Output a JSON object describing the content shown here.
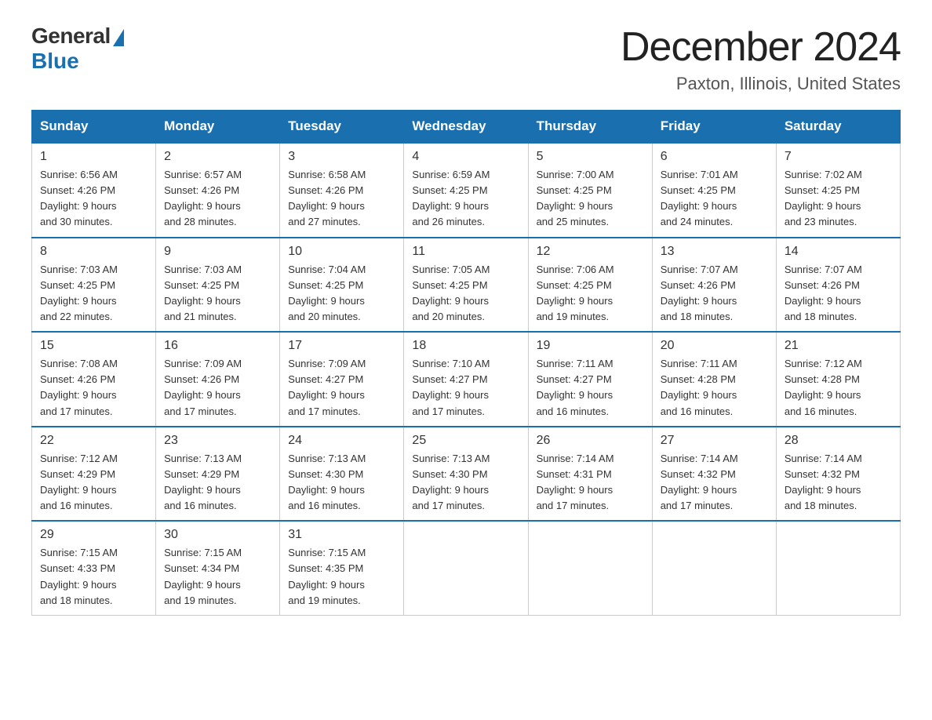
{
  "header": {
    "logo": {
      "general": "General",
      "blue": "Blue"
    },
    "title": "December 2024",
    "location": "Paxton, Illinois, United States"
  },
  "days_of_week": [
    "Sunday",
    "Monday",
    "Tuesday",
    "Wednesday",
    "Thursday",
    "Friday",
    "Saturday"
  ],
  "weeks": [
    [
      {
        "day": "1",
        "sunrise": "6:56 AM",
        "sunset": "4:26 PM",
        "daylight": "9 hours and 30 minutes."
      },
      {
        "day": "2",
        "sunrise": "6:57 AM",
        "sunset": "4:26 PM",
        "daylight": "9 hours and 28 minutes."
      },
      {
        "day": "3",
        "sunrise": "6:58 AM",
        "sunset": "4:26 PM",
        "daylight": "9 hours and 27 minutes."
      },
      {
        "day": "4",
        "sunrise": "6:59 AM",
        "sunset": "4:25 PM",
        "daylight": "9 hours and 26 minutes."
      },
      {
        "day": "5",
        "sunrise": "7:00 AM",
        "sunset": "4:25 PM",
        "daylight": "9 hours and 25 minutes."
      },
      {
        "day": "6",
        "sunrise": "7:01 AM",
        "sunset": "4:25 PM",
        "daylight": "9 hours and 24 minutes."
      },
      {
        "day": "7",
        "sunrise": "7:02 AM",
        "sunset": "4:25 PM",
        "daylight": "9 hours and 23 minutes."
      }
    ],
    [
      {
        "day": "8",
        "sunrise": "7:03 AM",
        "sunset": "4:25 PM",
        "daylight": "9 hours and 22 minutes."
      },
      {
        "day": "9",
        "sunrise": "7:03 AM",
        "sunset": "4:25 PM",
        "daylight": "9 hours and 21 minutes."
      },
      {
        "day": "10",
        "sunrise": "7:04 AM",
        "sunset": "4:25 PM",
        "daylight": "9 hours and 20 minutes."
      },
      {
        "day": "11",
        "sunrise": "7:05 AM",
        "sunset": "4:25 PM",
        "daylight": "9 hours and 20 minutes."
      },
      {
        "day": "12",
        "sunrise": "7:06 AM",
        "sunset": "4:25 PM",
        "daylight": "9 hours and 19 minutes."
      },
      {
        "day": "13",
        "sunrise": "7:07 AM",
        "sunset": "4:26 PM",
        "daylight": "9 hours and 18 minutes."
      },
      {
        "day": "14",
        "sunrise": "7:07 AM",
        "sunset": "4:26 PM",
        "daylight": "9 hours and 18 minutes."
      }
    ],
    [
      {
        "day": "15",
        "sunrise": "7:08 AM",
        "sunset": "4:26 PM",
        "daylight": "9 hours and 17 minutes."
      },
      {
        "day": "16",
        "sunrise": "7:09 AM",
        "sunset": "4:26 PM",
        "daylight": "9 hours and 17 minutes."
      },
      {
        "day": "17",
        "sunrise": "7:09 AM",
        "sunset": "4:27 PM",
        "daylight": "9 hours and 17 minutes."
      },
      {
        "day": "18",
        "sunrise": "7:10 AM",
        "sunset": "4:27 PM",
        "daylight": "9 hours and 17 minutes."
      },
      {
        "day": "19",
        "sunrise": "7:11 AM",
        "sunset": "4:27 PM",
        "daylight": "9 hours and 16 minutes."
      },
      {
        "day": "20",
        "sunrise": "7:11 AM",
        "sunset": "4:28 PM",
        "daylight": "9 hours and 16 minutes."
      },
      {
        "day": "21",
        "sunrise": "7:12 AM",
        "sunset": "4:28 PM",
        "daylight": "9 hours and 16 minutes."
      }
    ],
    [
      {
        "day": "22",
        "sunrise": "7:12 AM",
        "sunset": "4:29 PM",
        "daylight": "9 hours and 16 minutes."
      },
      {
        "day": "23",
        "sunrise": "7:13 AM",
        "sunset": "4:29 PM",
        "daylight": "9 hours and 16 minutes."
      },
      {
        "day": "24",
        "sunrise": "7:13 AM",
        "sunset": "4:30 PM",
        "daylight": "9 hours and 16 minutes."
      },
      {
        "day": "25",
        "sunrise": "7:13 AM",
        "sunset": "4:30 PM",
        "daylight": "9 hours and 17 minutes."
      },
      {
        "day": "26",
        "sunrise": "7:14 AM",
        "sunset": "4:31 PM",
        "daylight": "9 hours and 17 minutes."
      },
      {
        "day": "27",
        "sunrise": "7:14 AM",
        "sunset": "4:32 PM",
        "daylight": "9 hours and 17 minutes."
      },
      {
        "day": "28",
        "sunrise": "7:14 AM",
        "sunset": "4:32 PM",
        "daylight": "9 hours and 18 minutes."
      }
    ],
    [
      {
        "day": "29",
        "sunrise": "7:15 AM",
        "sunset": "4:33 PM",
        "daylight": "9 hours and 18 minutes."
      },
      {
        "day": "30",
        "sunrise": "7:15 AM",
        "sunset": "4:34 PM",
        "daylight": "9 hours and 19 minutes."
      },
      {
        "day": "31",
        "sunrise": "7:15 AM",
        "sunset": "4:35 PM",
        "daylight": "9 hours and 19 minutes."
      },
      null,
      null,
      null,
      null
    ]
  ],
  "labels": {
    "sunrise": "Sunrise:",
    "sunset": "Sunset:",
    "daylight": "Daylight: 9 hours"
  }
}
